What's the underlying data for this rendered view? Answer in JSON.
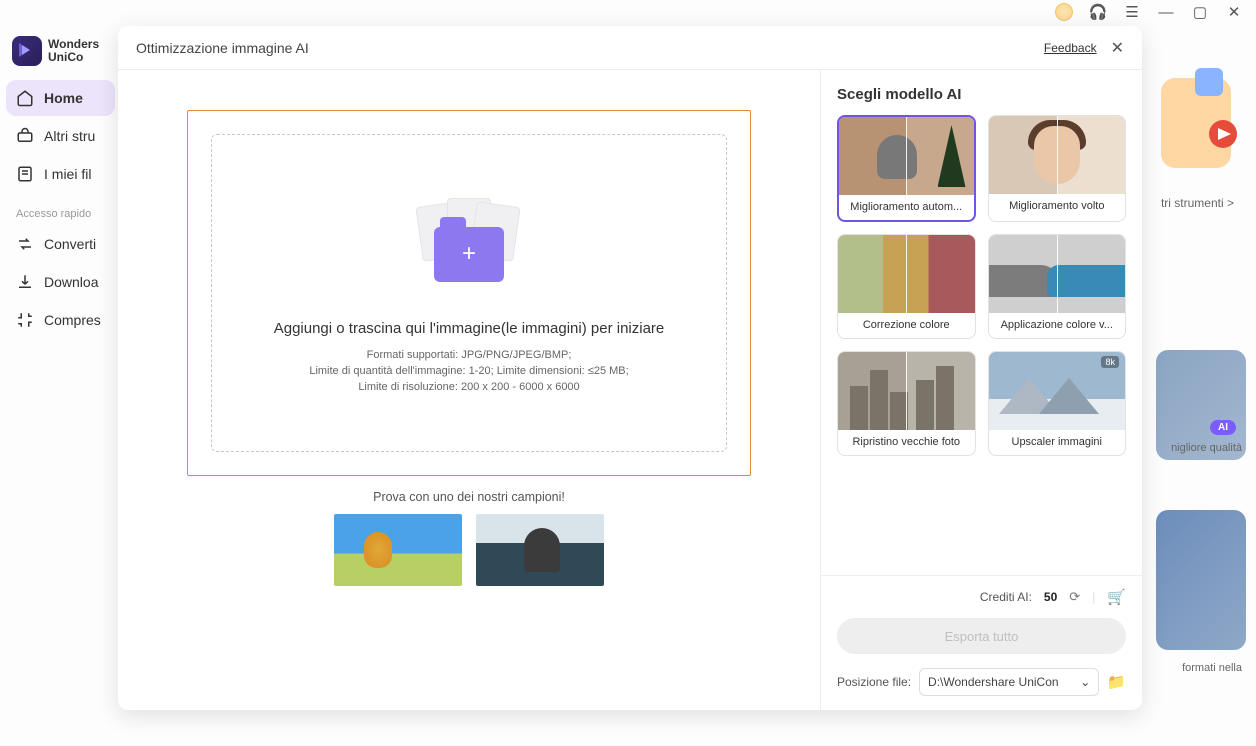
{
  "titlebar": {
    "min": "—",
    "sq": "▢",
    "close": "✕"
  },
  "app": {
    "brand_line1": "Wonders",
    "brand_line2": "UniCo"
  },
  "sidebar": {
    "items": [
      {
        "label": "Home"
      },
      {
        "label": "Altri stru"
      },
      {
        "label": "I miei fil"
      }
    ],
    "quick_label": "Accesso rapido",
    "quick": [
      {
        "label": "Converti"
      },
      {
        "label": "Downloa"
      },
      {
        "label": "Compres"
      }
    ]
  },
  "bg": {
    "promo": "tri strumenti  >",
    "ai_pill": "AI",
    "text1": "nigliore qualità",
    "text2": "formati nella"
  },
  "modal": {
    "title": "Ottimizzazione immagine AI",
    "feedback": "Feedback",
    "drop": {
      "headline": "Aggiungi o trascina qui l'immagine(le immagini) per iniziare",
      "line1": "Formati supportati: JPG/PNG/JPEG/BMP;",
      "line2": "Limite di quantità dell'immagine: 1-20; Limite dimensioni: ≤25 MB;",
      "line3": "Limite di risoluzione: 200 x 200 - 6000 x 6000"
    },
    "samples_label": "Prova con uno dei nostri campioni!"
  },
  "right": {
    "title": "Scegli modello AI",
    "models": [
      {
        "label": "Miglioramento autom..."
      },
      {
        "label": "Miglioramento volto"
      },
      {
        "label": "Correzione colore"
      },
      {
        "label": "Applicazione colore v..."
      },
      {
        "label": "Ripristino vecchie foto"
      },
      {
        "label": "Upscaler immagini"
      }
    ],
    "credits_label": "Crediti AI:",
    "credits_value": "50",
    "export": "Esporta tutto",
    "path_label": "Posizione file:",
    "path_value": "D:\\Wondershare UniCon"
  }
}
